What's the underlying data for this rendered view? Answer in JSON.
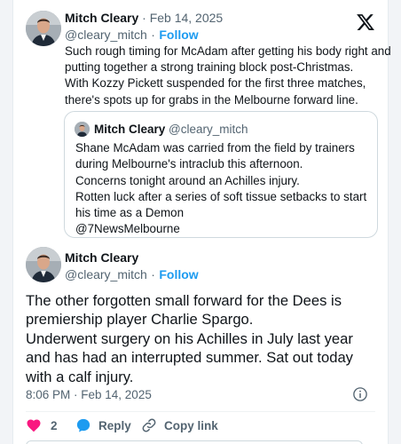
{
  "tweet1": {
    "name": "Mitch Cleary",
    "date": "· Feb 14, 2025",
    "handle": "@cleary_mitch",
    "follow": "Follow",
    "dot": "·",
    "lines": [
      "Such rough timing for McAdam after getting his body right and",
      "putting together a strong training block post-Christmas.",
      "With Kozzy Pickett suspended for the first three matches,",
      "there's spots up for grabs in the Melbourne forward line."
    ]
  },
  "quote": {
    "name": "Mitch Cleary",
    "handle": "@cleary_mitch",
    "lines": [
      "Shane McAdam was carried from the field by trainers",
      "during Melbourne's intraclub this afternoon.",
      "Concerns tonight around an Achilles injury.",
      "Rotten luck after a series of soft tissue setbacks to start",
      "his time as a Demon",
      "@7NewsMelbourne"
    ]
  },
  "tweet2": {
    "name": "Mitch Cleary",
    "handle": "@cleary_mitch",
    "dot": "·",
    "follow": "Follow",
    "lines": [
      "The other forgotten small forward for the Dees is",
      "premiership player Charlie Spargo.",
      "Underwent surgery on his Achilles in July last year",
      "and has had an interrupted summer. Sat out today",
      "with a calf injury."
    ],
    "timestamp": "8:06 PM · Feb 14, 2025"
  },
  "actions": {
    "like_count": "2",
    "reply_label": "Reply",
    "copy_label": "Copy link"
  },
  "colors": {
    "accent": "#1d9bf0",
    "like": "#f91880",
    "muted": "#536471"
  },
  "icons": [
    "x-logo-icon",
    "info-icon",
    "heart-icon",
    "reply-icon",
    "link-icon"
  ]
}
